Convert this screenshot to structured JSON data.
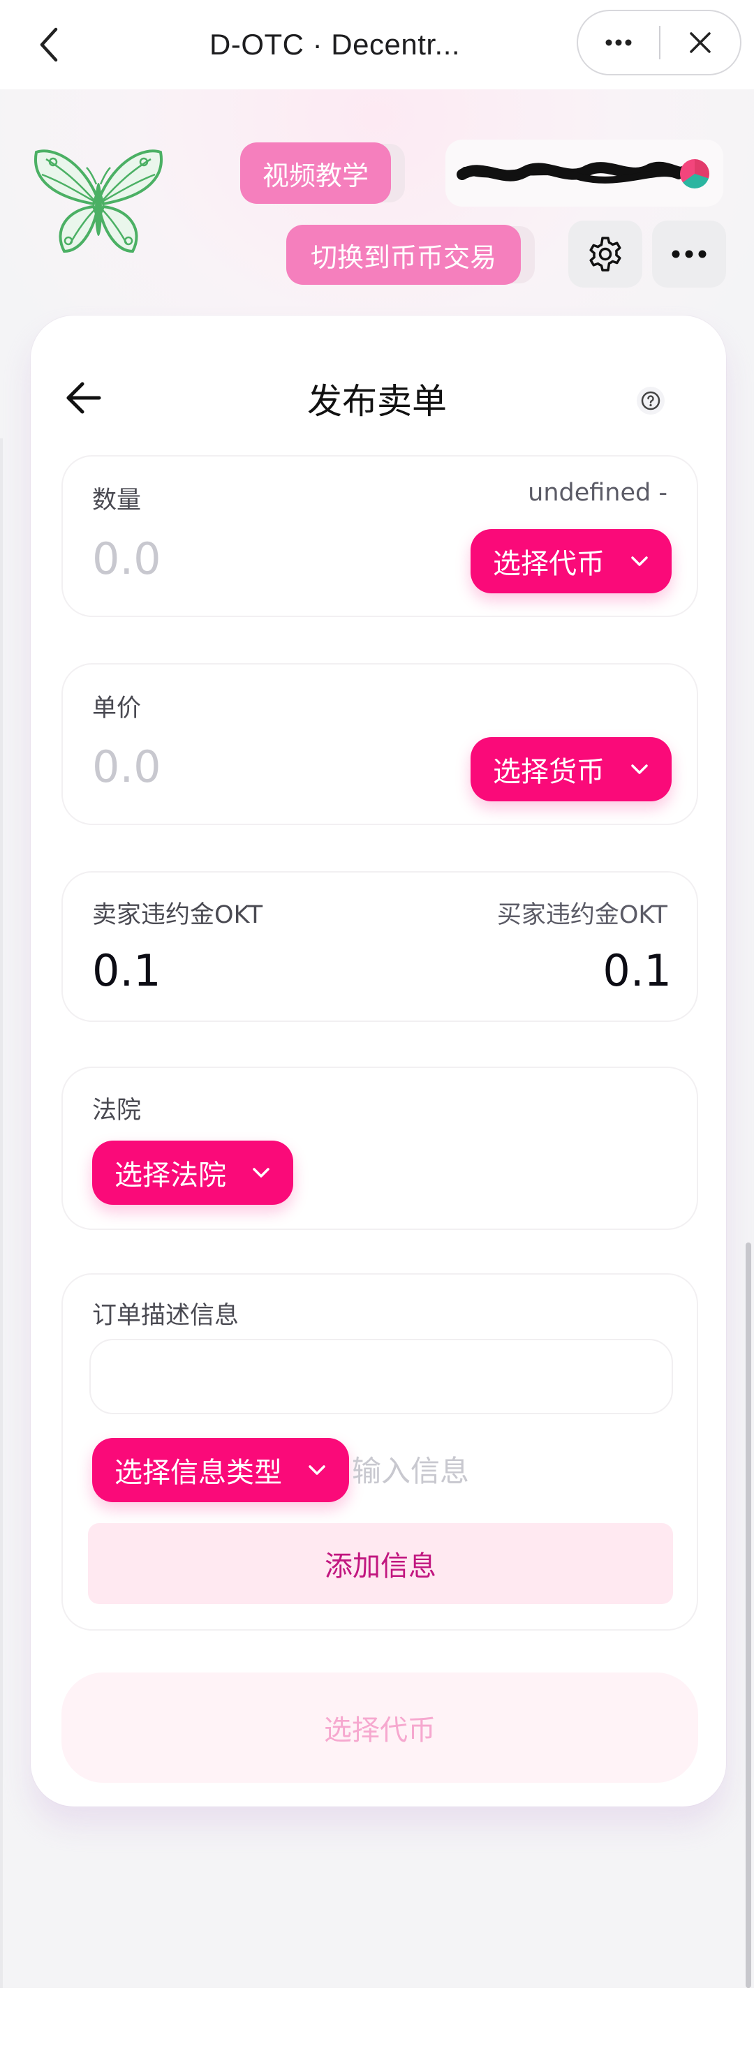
{
  "app_bar": {
    "title": "D-OTC · Decentr..."
  },
  "header": {
    "video_tutorial_label": "视频教学",
    "switch_label": "切换到币币交易"
  },
  "card": {
    "title": "发布卖单",
    "quantity": {
      "label": "数量",
      "balance": "undefined -",
      "placeholder": "0.0",
      "token_button": "选择代币"
    },
    "price": {
      "label": "单价",
      "placeholder": "0.0",
      "currency_button": "选择货币"
    },
    "deposit": {
      "left_label": "卖家违约金OKT",
      "left_value": "0.1",
      "right_label": "买家违约金OKT",
      "right_value": "0.1"
    },
    "court": {
      "label": "法院",
      "button": "选择法院"
    },
    "description": {
      "label": "订单描述信息",
      "type_button": "选择信息类型",
      "input_placeholder": "输入信息",
      "add_button": "添加信息"
    },
    "submit_label": "选择代币"
  },
  "colors": {
    "accent": "#fa0a79",
    "pill_pink": "#f57fbd",
    "logo_green": "#4bb064"
  },
  "icons": [
    "back-chevron-icon",
    "more-icon",
    "close-icon",
    "butterfly-logo-icon",
    "gear-icon",
    "ellipsis-icon",
    "arrow-left-icon",
    "help-icon",
    "chevron-down-icon"
  ]
}
